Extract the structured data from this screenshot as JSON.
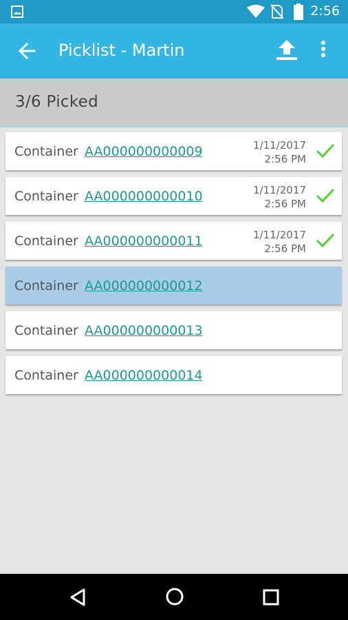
{
  "status_bar": {
    "time": "2:56"
  },
  "app_bar": {
    "title": "Picklist - Martin"
  },
  "summary": {
    "text": "3/6  Picked"
  },
  "items": [
    {
      "label": "Container",
      "code": "AA000000000009",
      "date": "1/11/2017",
      "time": "2:56 PM",
      "picked": true
    },
    {
      "label": "Container",
      "code": "AA000000000010",
      "date": "1/11/2017",
      "time": "2:56 PM",
      "picked": true
    },
    {
      "label": "Container",
      "code": "AA000000000011",
      "date": "1/11/2017",
      "time": "2:56 PM",
      "picked": true
    },
    {
      "label": "Container",
      "code": "AA000000000012",
      "date": "",
      "time": "",
      "picked": false,
      "selected": true
    },
    {
      "label": "Container",
      "code": "AA000000000013",
      "date": "",
      "time": "",
      "picked": false
    },
    {
      "label": "Container",
      "code": "AA000000000014",
      "date": "",
      "time": "",
      "picked": false
    }
  ],
  "colors": {
    "app_bar": "#33b5e5",
    "status_bar": "#1f9bc7",
    "link": "#1a9a96",
    "check": "#4cd137",
    "selected_row": "#a7cde8"
  },
  "icons": [
    "image-icon",
    "wifi-icon",
    "no-sim-icon",
    "battery-icon",
    "back-arrow-icon",
    "upload-icon",
    "more-vert-icon",
    "check-icon",
    "nav-back-icon",
    "nav-home-icon",
    "nav-recents-icon"
  ]
}
